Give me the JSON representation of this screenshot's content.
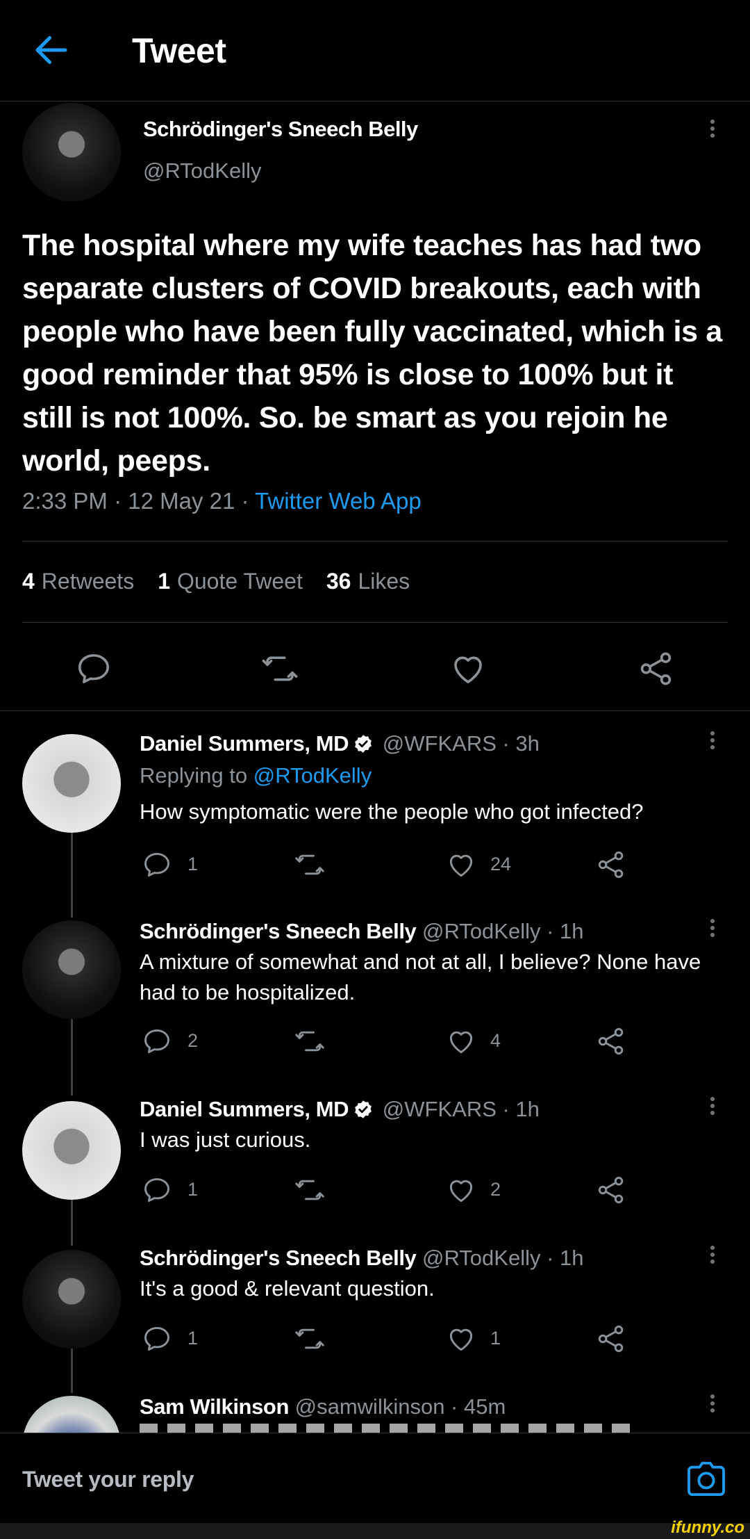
{
  "header": {
    "title": "Tweet",
    "back_icon": "arrow-left-icon"
  },
  "main_tweet": {
    "author_name": "Schrödinger's Sneech Belly",
    "author_handle": "@RTodKelly",
    "text": "The hospital where my wife teaches has had two separate clusters of COVID breakouts, each with people who have been fully vaccinated, which is a good reminder that 95% is close to 100% but it still is not 100%. So. be smart as you rejoin he world, peeps.",
    "time": "2:33 PM · 12 May 21 · ",
    "source": "Twitter Web App",
    "retweets_count": "4",
    "retweets_label": "Retweets",
    "quotes_count": "1",
    "quotes_label": "Quote Tweet",
    "likes_count": "36",
    "likes_label": "Likes"
  },
  "replies": [
    {
      "name": "Daniel Summers, MD",
      "verified": true,
      "handle_time": "@WFKARS · 3h",
      "replying_prefix": "Replying to ",
      "replying_to": "@RTodKelly",
      "text": "How symptomatic were the people who got infected?",
      "reply_count": "1",
      "like_count": "24"
    },
    {
      "name": "Schrödinger's Sneech Belly",
      "verified": false,
      "handle_time": "@RTodKelly · 1h",
      "text": "A mixture of somewhat and not at all, I believe? None have had to be hospitalized.",
      "reply_count": "2",
      "like_count": "4"
    },
    {
      "name": "Daniel Summers, MD",
      "verified": true,
      "handle_time": "@WFKARS · 1h",
      "text": "I was just curious.",
      "reply_count": "1",
      "like_count": "2"
    },
    {
      "name": "Schrödinger's Sneech Belly",
      "verified": false,
      "handle_time": "@RTodKelly · 1h",
      "text": "It's a good & relevant question.",
      "reply_count": "1",
      "like_count": "1"
    },
    {
      "name": "Sam Wilkinson",
      "verified": false,
      "handle_time": "@samwilkinson · 45m"
    }
  ],
  "composer": {
    "placeholder": "Tweet your reply",
    "camera_icon": "camera-icon"
  },
  "watermark": "ifunny.co",
  "colors": {
    "accent": "#1d9bf0",
    "muted": "#8b9298",
    "background": "#000000",
    "divider": "#2f3336"
  }
}
